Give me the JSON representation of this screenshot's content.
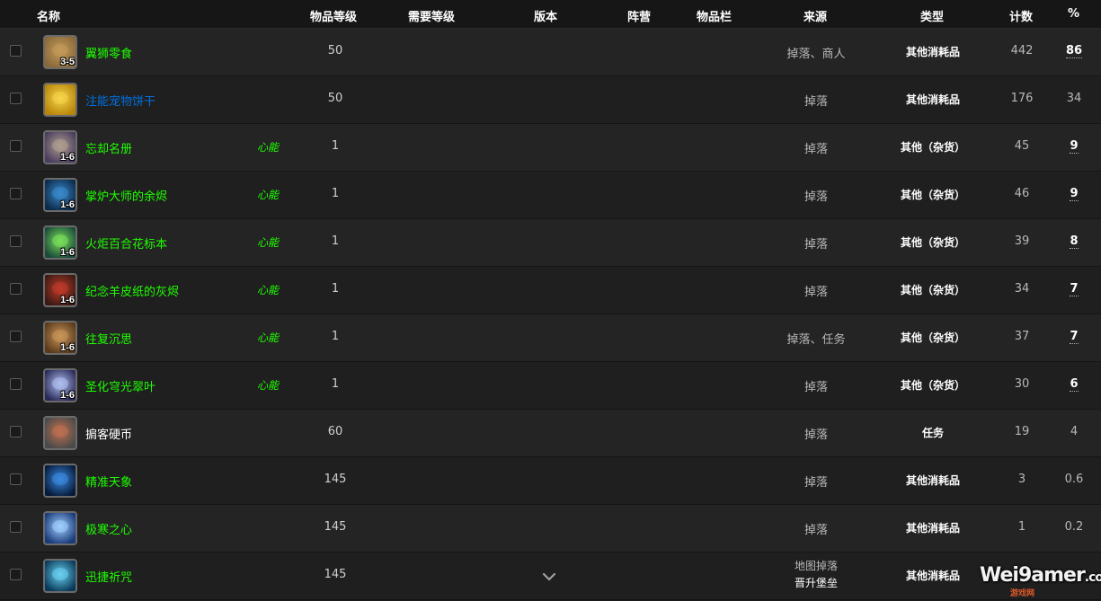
{
  "header": {
    "name": "名称",
    "item_level": "物品等级",
    "req_level": "需要等级",
    "version": "版本",
    "faction": "阵营",
    "slot": "物品栏",
    "source": "来源",
    "type": "类型",
    "count": "计数",
    "percent": "%"
  },
  "rows": [
    {
      "name": "翼狮零食",
      "quality": "green",
      "icon": "snack-icon",
      "stack": "3-5",
      "tag": "",
      "ilvl": "50",
      "source": "掉落、商人",
      "type": "其他消耗品",
      "count": "442",
      "percent": "86",
      "pct_link": true
    },
    {
      "name": "注能宠物饼干",
      "quality": "blue",
      "icon": "biscuit-icon",
      "stack": "",
      "tag": "",
      "ilvl": "50",
      "source": "掉落",
      "type": "其他消耗品",
      "count": "176",
      "percent": "34",
      "pct_link": false
    },
    {
      "name": "忘却名册",
      "quality": "green",
      "icon": "scroll-icon",
      "stack": "1-6",
      "tag": "心能",
      "ilvl": "1",
      "source": "掉落",
      "type": "其他（杂货）",
      "count": "45",
      "percent": "9",
      "pct_link": true
    },
    {
      "name": "掌炉大师的余烬",
      "quality": "green",
      "icon": "ember-icon",
      "stack": "1-6",
      "tag": "心能",
      "ilvl": "1",
      "source": "掉落",
      "type": "其他（杂货）",
      "count": "46",
      "percent": "9",
      "pct_link": true
    },
    {
      "name": "火炬百合花标本",
      "quality": "green",
      "icon": "lily-icon",
      "stack": "1-6",
      "tag": "心能",
      "ilvl": "1",
      "source": "掉落",
      "type": "其他（杂货）",
      "count": "39",
      "percent": "8",
      "pct_link": true
    },
    {
      "name": "纪念羊皮纸的灰烬",
      "quality": "green",
      "icon": "ashes-icon",
      "stack": "1-6",
      "tag": "心能",
      "ilvl": "1",
      "source": "掉落",
      "type": "其他（杂货）",
      "count": "34",
      "percent": "7",
      "pct_link": true
    },
    {
      "name": "往复沉思",
      "quality": "green",
      "icon": "book-icon",
      "stack": "1-6",
      "tag": "心能",
      "ilvl": "1",
      "source": "掉落、任务",
      "type": "其他（杂货）",
      "count": "37",
      "percent": "7",
      "pct_link": true
    },
    {
      "name": "圣化穹光翠叶",
      "quality": "green",
      "icon": "leaf-icon",
      "stack": "1-6",
      "tag": "心能",
      "ilvl": "1",
      "source": "掉落",
      "type": "其他（杂货）",
      "count": "30",
      "percent": "6",
      "pct_link": true
    },
    {
      "name": "掮客硬币",
      "quality": "white",
      "icon": "coin-icon",
      "stack": "",
      "tag": "",
      "ilvl": "60",
      "source": "掉落",
      "type": "任务",
      "count": "19",
      "percent": "4",
      "pct_link": false
    },
    {
      "name": "精准天象",
      "quality": "green",
      "icon": "starry-icon",
      "stack": "",
      "tag": "",
      "ilvl": "145",
      "source": "掉落",
      "type": "其他消耗品",
      "count": "3",
      "percent": "0.6",
      "pct_link": false
    },
    {
      "name": "极寒之心",
      "quality": "green",
      "icon": "frost-icon",
      "stack": "",
      "tag": "",
      "ilvl": "145",
      "source": "掉落",
      "type": "其他消耗品",
      "count": "1",
      "percent": "0.2",
      "pct_link": false
    },
    {
      "name": "迅捷祈咒",
      "quality": "green",
      "icon": "rune-icon",
      "stack": "",
      "tag": "",
      "ilvl": "145",
      "source_line1": "地图掉落",
      "source_line2": "晋升堡垒",
      "type": "其他消耗品",
      "count": "",
      "percent": "",
      "pct_link": false
    }
  ],
  "icon_colors": {
    "snack-icon": [
      "#8a6a3a",
      "#c49a5a"
    ],
    "biscuit-icon": [
      "#b8860b",
      "#f5d44a"
    ],
    "scroll-icon": [
      "#4a3d5e",
      "#b0a090"
    ],
    "ember-icon": [
      "#0c2a4a",
      "#3a8acc"
    ],
    "lily-icon": [
      "#1a4a3a",
      "#7ae05a"
    ],
    "ashes-icon": [
      "#3a1a14",
      "#c03a2a"
    ],
    "book-icon": [
      "#5a3a1a",
      "#c9955a"
    ],
    "leaf-icon": [
      "#2a2a5a",
      "#b0c0f0"
    ],
    "coin-icon": [
      "#4a4a4a",
      "#c07050"
    ],
    "starry-icon": [
      "#061a3a",
      "#3a8ae0"
    ],
    "frost-icon": [
      "#1a3a7a",
      "#a0d0ff"
    ],
    "rune-icon": [
      "#0a3a5a",
      "#6ad0f0"
    ]
  },
  "quality_colors": {
    "green": "#1eff00",
    "blue": "#0070dd",
    "white": "#ffffff"
  },
  "watermark": {
    "text": "Wei9amer",
    "sub": ".com",
    "sub2": "游戏网"
  }
}
